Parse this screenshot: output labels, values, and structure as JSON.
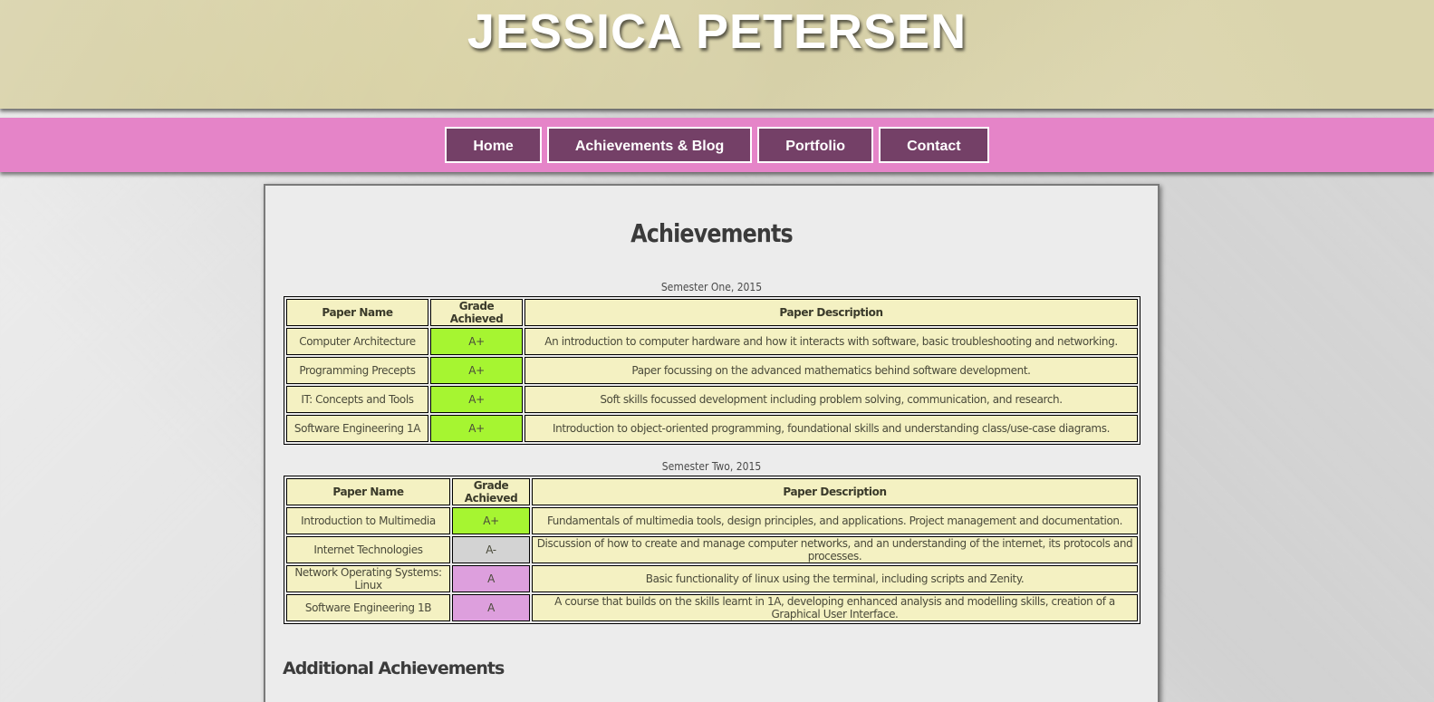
{
  "header": {
    "title": "JESSICA PETERSEN"
  },
  "nav": {
    "items": [
      "Home",
      "Achievements & Blog",
      "Portfolio",
      "Contact"
    ]
  },
  "main": {
    "title": "Achievements",
    "additional_heading": "Additional Achievements"
  },
  "tables": [
    {
      "caption": "Semester One, 2015",
      "headers": [
        "Paper Name",
        "Grade Achieved",
        "Paper Description"
      ],
      "rows": [
        [
          "Computer Architecture",
          "A+",
          "An introduction to computer hardware and how it interacts with software, basic troubleshooting and networking."
        ],
        [
          "Programming Precepts",
          "A+",
          "Paper focussing on the advanced mathematics behind software development."
        ],
        [
          "IT: Concepts and Tools",
          "A+",
          "Soft skills focussed development including problem solving, communication, and research."
        ],
        [
          "Software Engineering 1A",
          "A+",
          "Introduction to object-oriented programming, foundational skills and understanding class/use-case diagrams."
        ]
      ]
    },
    {
      "caption": "Semester Two, 2015",
      "headers": [
        "Paper Name",
        "Grade Achieved",
        "Paper Description"
      ],
      "rows": [
        [
          "Introduction to Multimedia",
          "A+",
          "Fundamentals of multimedia tools, design principles, and applications. Project management and documentation."
        ],
        [
          "Internet Technologies",
          "A-",
          "Discussion of how to create and manage computer networks, and an understanding of the internet, its protocols and processes."
        ],
        [
          "Network Operating Systems: Linux",
          "A",
          "Basic functionality of linux using the terminal, including scripts and Zenity."
        ],
        [
          "Software Engineering 1B",
          "A",
          "A course that builds on the skills learnt in 1A, developing enhanced analysis and modelling skills, creation of a Graphical User Interface."
        ]
      ]
    }
  ],
  "colors": {
    "header_bg": "#dcd5a7",
    "nav_bg": "#e584c8",
    "nav_button_bg": "#744067",
    "grade_a_plus": "#a6f531",
    "grade_a_minus": "#d3d3d3",
    "grade_a": "#dd9fdd",
    "cell_bg": "#f4f1c2"
  }
}
